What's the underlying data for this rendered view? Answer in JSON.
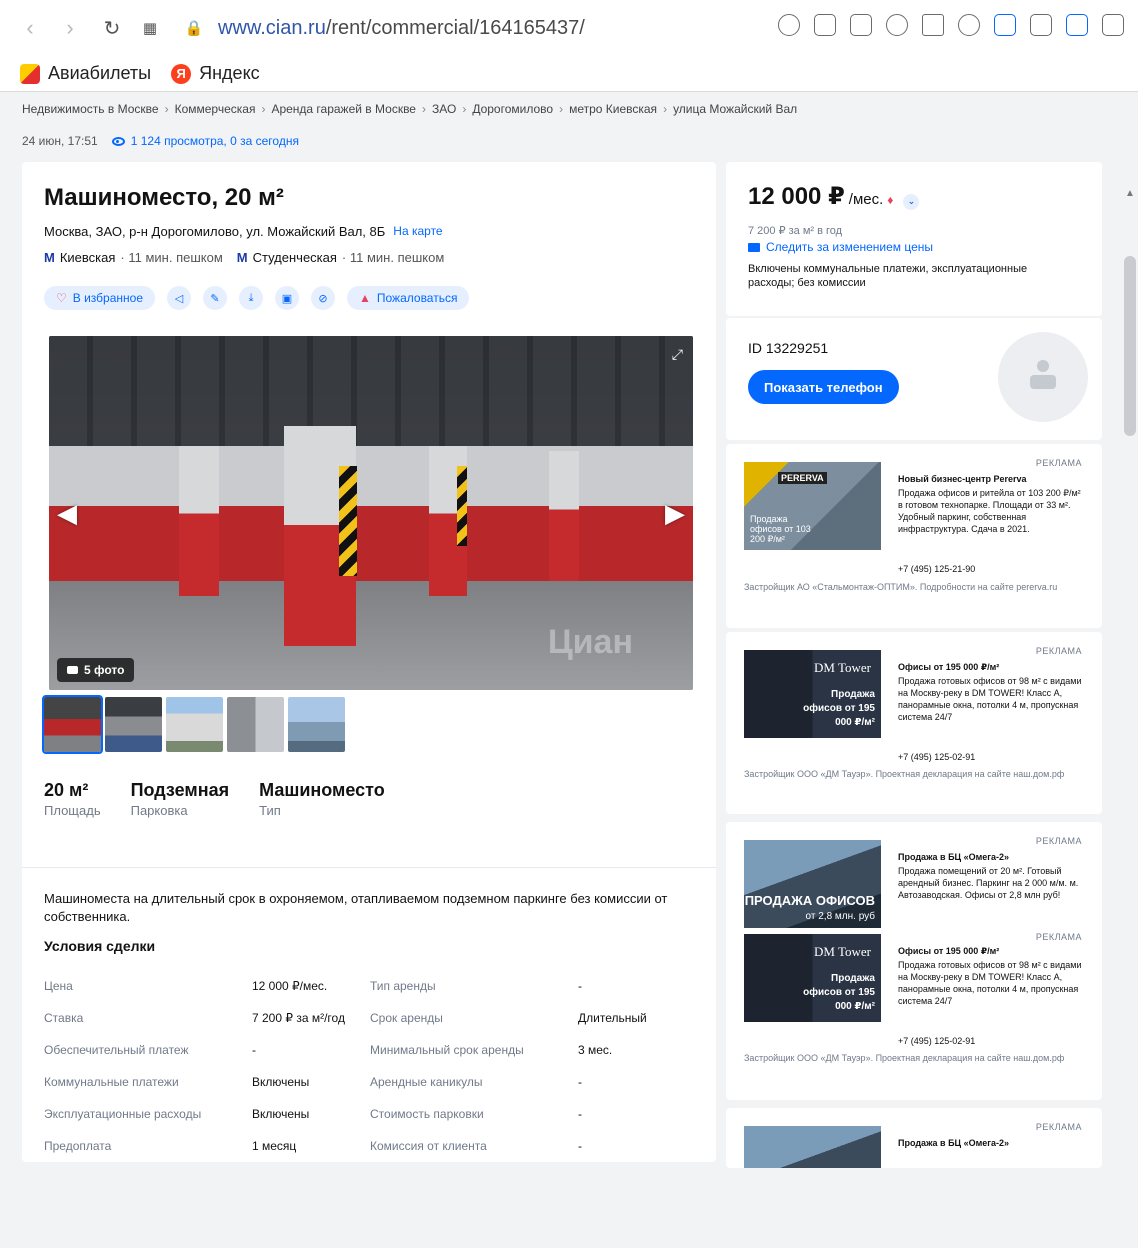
{
  "browser": {
    "url_host": "www.cian.ru",
    "url_path": "/rent/commercial/164165437/",
    "bookmarks": [
      {
        "label": "Авиабилеты"
      },
      {
        "label": "Яндекс",
        "icon_letter": "Я"
      }
    ]
  },
  "breadcrumbs": [
    "Недвижимость в Москве",
    "Коммерческая",
    "Аренда гаражей в Москве",
    "ЗАО",
    "Дорогомилово",
    "метро Киевская",
    "улица Можайский Вал"
  ],
  "meta": {
    "date": "24 июн, 17:51",
    "views": "1 124 просмотра, 0 за сегодня"
  },
  "listing": {
    "title": "Машиноместо, 20 м²",
    "address": "Москва, ЗАО, р-н Дорогомилово, ул. Можайский Вал, 8Б",
    "map_link": "На карте",
    "metro": [
      {
        "name": "Киевская",
        "time": " · 11 мин. пешком",
        "icon": "М"
      },
      {
        "name": "Студенческая",
        "time": " · 11 мин. пешком",
        "icon": "М"
      }
    ],
    "actions": {
      "favorite": "В избранное",
      "complain": "Пожаловаться"
    },
    "photo_count": "5 фото",
    "watermark": "Циан",
    "facts": [
      {
        "value": "20 м²",
        "label": "Площадь"
      },
      {
        "value": "Подземная",
        "label": "Парковка"
      },
      {
        "value": "Машиноместо",
        "label": "Тип"
      }
    ],
    "description": "Машиноместа на длительный срок в охроняемом, отапливаемом подземном паркинге без комиссии от собствeнника.",
    "deal_title": "Условия сделки",
    "deal_rows": [
      {
        "k1": "Цена",
        "v1": "12 000 ₽/мес.",
        "k2": "Тип аренды",
        "v2": "-"
      },
      {
        "k1": "Ставка",
        "v1": "7 200 ₽ за м²/год",
        "k2": "Срок аренды",
        "v2": "Длительный"
      },
      {
        "k1": "Обеспечительный платеж",
        "v1": "-",
        "k2": "Минимальный срок аренды",
        "v2": "3 мес."
      },
      {
        "k1": "Коммунальные платежи",
        "v1": "Включены",
        "k2": "Арендные каникулы",
        "v2": "-"
      },
      {
        "k1": "Эксплуатационные расходы",
        "v1": "Включены",
        "k2": "Стоимость парковки",
        "v2": "-"
      },
      {
        "k1": "Предоплата",
        "v1": "1 месяц",
        "k2": "Комиссия от клиента",
        "v2": "-"
      }
    ]
  },
  "price": {
    "value": "12 000 ₽",
    "period": "/мес.",
    "per_meter": "7 200 ₽ за м² в год",
    "watch": "Следить за изменением цены",
    "included": "Включены коммунальные платежи, эксплуатационные расходы; без комиссии"
  },
  "seller": {
    "id": "ID 13229251",
    "phone_button": "Показать телефон"
  },
  "ads": [
    {
      "label": "РЕКЛАМА",
      "title": "Новый бизнес-центр Pererva",
      "text": "Продажа офисов и ритейла от 103 200 ₽/м² в готовом технопарке. Площади от 33 м². Удобный паркинг, собственная инфраструктура. Сдача в 2021.",
      "phone": "+7 (495) 125-21-90",
      "footer": "Застройщик АО «Стальмонтаж-ОПТИМ». Подробности на сайте pererva.ru",
      "img_logo": "PERERVA",
      "img_text": "Продажа офисов от 103 200 ₽/м²"
    },
    {
      "label": "РЕКЛАМА",
      "title": "Офисы от 195 000 ₽/м²",
      "text": "Продажа готовых офисов от 98 м² с видами на Москву-реку в DM TOWER! Класс А, панорамные окна, потолки 4 м, пропускная система 24/7",
      "phone": "+7 (495) 125-02-91",
      "footer": "Застройщик ООО «ДМ Тауэр». Проектная декларация на сайте наш.дом.рф",
      "img_logo": "DM Tower",
      "img_text": "Продажа офисов от 195 000 ₽/м²"
    },
    {
      "label": "РЕКЛАМА",
      "title": "Продажа в БЦ «Омега-2»",
      "text": "Продажа помещений от 20 м². Готовый арендный бизнес. Паркинг на 2 000 м/м. м. Автозаводская. Офисы от 2,8 млн руб!",
      "img_big": "ПРОДАЖА ОФИСОВ",
      "img_text": "от 2,8 млн. руб"
    },
    {
      "label": "РЕКЛАМА",
      "title": "Офисы от 195 000 ₽/м²",
      "text": "Продажа готовых офисов от 98 м² с видами на Москву-реку в DM TOWER! Класс А, панорамные окна, потолки 4 м, пропускная система 24/7",
      "phone": "+7 (495) 125-02-91",
      "footer": "Застройщик ООО «ДМ Тауэр». Проектная декларация на сайте наш.дом.рф",
      "img_logo": "DM Tower",
      "img_text": "Продажа офисов от 195 000 ₽/м²"
    },
    {
      "label": "РЕКЛАМА",
      "title": "Продажа в БЦ «Омега-2»"
    }
  ],
  "colors": {
    "accent": "#0468ff",
    "danger": "#e84260",
    "metro": "#1a3ba5"
  }
}
